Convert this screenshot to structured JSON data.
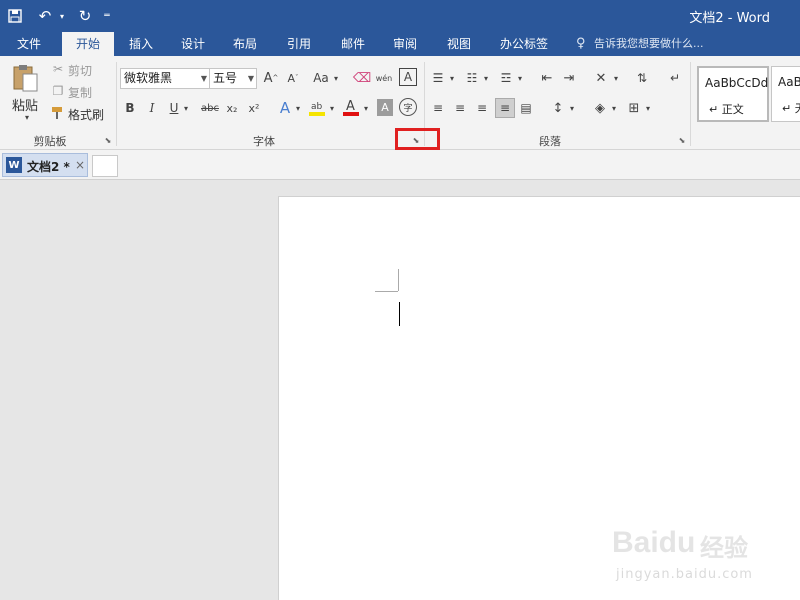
{
  "window": {
    "title": "文档2 - Word"
  },
  "quick_access": {
    "save_icon": "save-icon",
    "undo_icon": "undo-icon",
    "redo_icon": "redo-icon",
    "customize_icon": "customize-qat-icon"
  },
  "tabs": [
    {
      "label": "文件",
      "active": false
    },
    {
      "label": "开始",
      "active": true
    },
    {
      "label": "插入",
      "active": false
    },
    {
      "label": "设计",
      "active": false
    },
    {
      "label": "布局",
      "active": false
    },
    {
      "label": "引用",
      "active": false
    },
    {
      "label": "邮件",
      "active": false
    },
    {
      "label": "审阅",
      "active": false
    },
    {
      "label": "视图",
      "active": false
    },
    {
      "label": "办公标签",
      "active": false
    }
  ],
  "tell_me": {
    "placeholder": "告诉我您想要做什么..."
  },
  "ribbon": {
    "clipboard": {
      "group_label": "剪贴板",
      "paste": "粘贴",
      "cut": "剪切",
      "copy": "复制",
      "format_painter": "格式刷"
    },
    "font": {
      "group_label": "字体",
      "font_name": "微软雅黑",
      "font_size": "五号",
      "change_case": "Aa",
      "phonetic": "wén",
      "bold": "B",
      "italic": "I",
      "underline": "U",
      "strike": "abc",
      "subscript": "x₂",
      "superscript": "x²",
      "enclose": "字"
    },
    "paragraph": {
      "group_label": "段落"
    },
    "styles": [
      {
        "sample": "AaBbCcDd",
        "name": "正文"
      },
      {
        "sample": "AaBbCcDd",
        "name": "无"
      }
    ]
  },
  "document_tab": {
    "label": "文档2 *",
    "close": "×"
  },
  "watermark": {
    "logo": "Baidu",
    "cn": "经验",
    "sub": "jingyan.baidu.com"
  },
  "colors": {
    "accent": "#2b579a",
    "ribbon_bg": "#f3f3f3",
    "annotation": "#e02020"
  }
}
